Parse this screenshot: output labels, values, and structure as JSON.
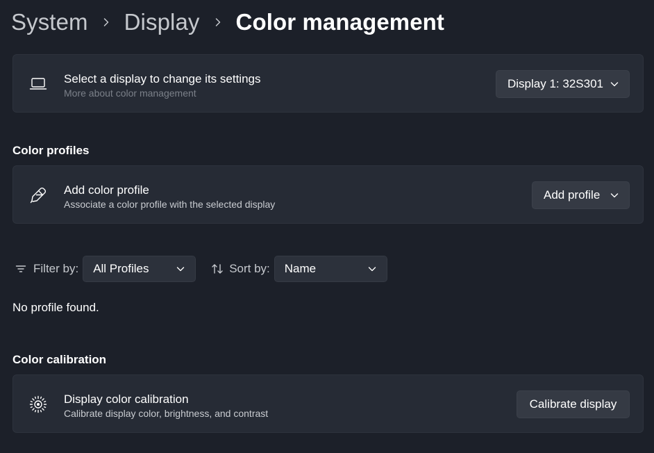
{
  "breadcrumb": {
    "items": [
      "System",
      "Display"
    ],
    "current": "Color management"
  },
  "display_card": {
    "title": "Select a display to change its settings",
    "subtitle": "More about color management",
    "icon": "laptop-icon",
    "dropdown_value": "Display 1: 32S301"
  },
  "color_profiles": {
    "heading": "Color profiles",
    "add_card": {
      "title": "Add color profile",
      "subtitle": "Associate a color profile with the selected display",
      "icon": "eyedropper-icon",
      "button_label": "Add profile"
    },
    "filter": {
      "label": "Filter by:",
      "value": "All Profiles"
    },
    "sort": {
      "label": "Sort by:",
      "value": "Name"
    },
    "empty_message": "No profile found."
  },
  "color_calibration": {
    "heading": "Color calibration",
    "card": {
      "title": "Display color calibration",
      "subtitle": "Calibrate display color, brightness, and contrast",
      "icon": "brightness-icon",
      "button_label": "Calibrate display"
    }
  }
}
